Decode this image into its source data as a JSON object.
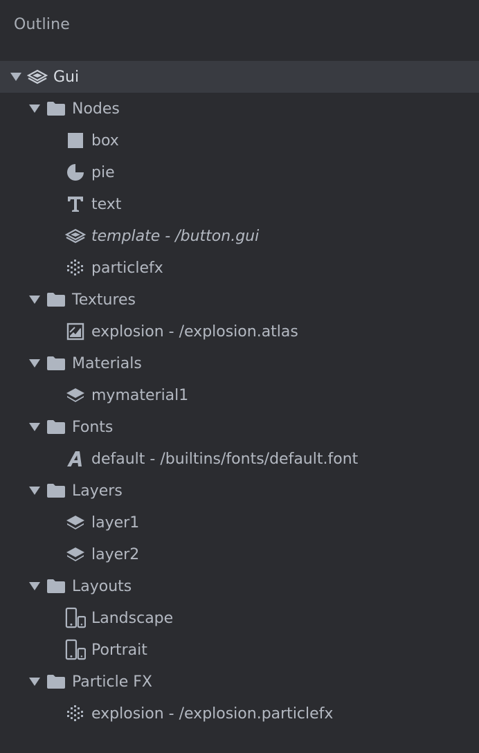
{
  "panel": {
    "title": "Outline"
  },
  "tree": {
    "root": {
      "label": "Gui",
      "icon": "gui-layers-icon",
      "expanded": true,
      "selected": true
    },
    "nodes": {
      "label": "Nodes",
      "items": [
        {
          "label": "box",
          "icon": "box-icon"
        },
        {
          "label": "pie",
          "icon": "pie-icon"
        },
        {
          "label": "text",
          "icon": "text-icon"
        },
        {
          "label": "template - /button.gui",
          "icon": "template-icon",
          "italic": true
        },
        {
          "label": "particlefx",
          "icon": "particlefx-icon"
        }
      ]
    },
    "textures": {
      "label": "Textures",
      "items": [
        {
          "label": "explosion - /explosion.atlas",
          "icon": "atlas-icon"
        }
      ]
    },
    "materials": {
      "label": "Materials",
      "items": [
        {
          "label": "mymaterial1",
          "icon": "material-icon"
        }
      ]
    },
    "fonts": {
      "label": "Fonts",
      "items": [
        {
          "label": "default - /builtins/fonts/default.font",
          "icon": "font-icon"
        }
      ]
    },
    "layers": {
      "label": "Layers",
      "items": [
        {
          "label": "layer1",
          "icon": "layer-icon"
        },
        {
          "label": "layer2",
          "icon": "layer-icon"
        }
      ]
    },
    "layouts": {
      "label": "Layouts",
      "items": [
        {
          "label": "Landscape",
          "icon": "layout-icon"
        },
        {
          "label": "Portrait",
          "icon": "layout-icon"
        }
      ]
    },
    "particle_fx": {
      "label": "Particle FX",
      "items": [
        {
          "label": "explosion - /explosion.particlefx",
          "icon": "particlefx-icon"
        }
      ]
    }
  },
  "colors": {
    "background": "#2b2c30",
    "selected_row": "#393b41",
    "text": "#b4b9c2",
    "icon": "#aeb5c0"
  }
}
